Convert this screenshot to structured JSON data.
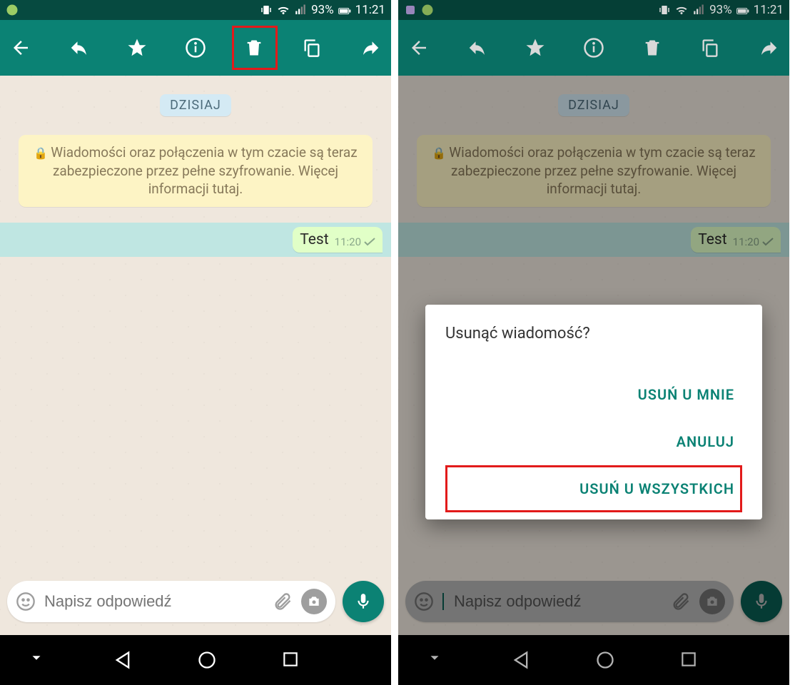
{
  "statusbar": {
    "battery_pct": "93%",
    "time": "11:21"
  },
  "chat": {
    "date_label": "DZISIAJ",
    "encryption_text": "Wiadomości oraz połączenia w tym czacie są teraz zabezpieczone przez pełne szyfrowanie. Więcej informacji tutaj.",
    "message_text": "Test",
    "message_time": "11:20"
  },
  "input": {
    "placeholder": "Napisz odpowiedź"
  },
  "dialog": {
    "title": "Usunąć wiadomość?",
    "delete_for_me": "USUŃ U MNIE",
    "cancel": "ANULUJ",
    "delete_for_all": "USUŃ U WSZYSTKICH"
  }
}
